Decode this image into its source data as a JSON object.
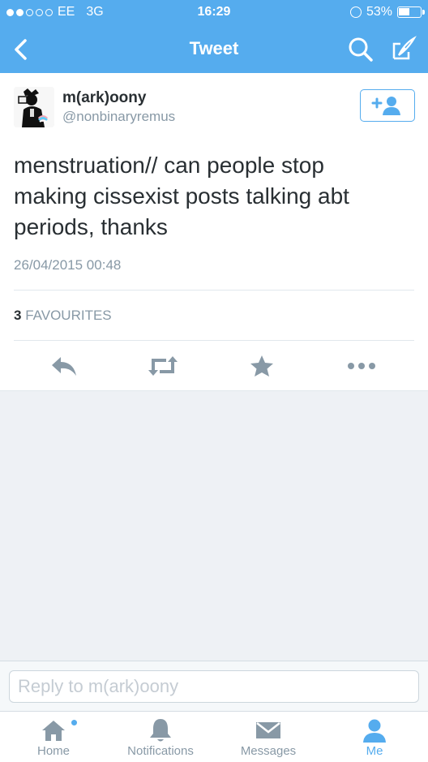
{
  "status_bar": {
    "carrier": "EE",
    "network": "3G",
    "time": "16:29",
    "battery_percent_label": "53%",
    "battery_level": 0.53,
    "signal_bars_filled": 2,
    "signal_bars_total": 5
  },
  "nav": {
    "title": "Tweet",
    "back_icon": "chevron-left-icon",
    "search_icon": "search-icon",
    "compose_icon": "compose-icon"
  },
  "tweet": {
    "display_name": "m(ark)oony",
    "handle": "@nonbinaryremus",
    "text": "menstruation// can people stop making cissexist posts talking abt periods, thanks",
    "timestamp": "26/04/2015 00:48",
    "favourites_count": "3",
    "favourites_label": "FAVOURITES",
    "follow_icon": "add-user-icon",
    "actions": [
      {
        "name": "reply",
        "icon": "reply-icon"
      },
      {
        "name": "retweet",
        "icon": "retweet-icon"
      },
      {
        "name": "favourite",
        "icon": "star-icon"
      },
      {
        "name": "more",
        "icon": "more-icon"
      }
    ]
  },
  "reply": {
    "placeholder": "Reply to m(ark)oony"
  },
  "tabs": [
    {
      "label": "Home",
      "icon": "home-icon",
      "active": false,
      "has_dot": true
    },
    {
      "label": "Notifications",
      "icon": "bell-icon",
      "active": false
    },
    {
      "label": "Messages",
      "icon": "envelope-icon",
      "active": false
    },
    {
      "label": "Me",
      "icon": "person-icon",
      "active": true
    }
  ],
  "colors": {
    "brand": "#55acee",
    "text": "#292f33",
    "muted": "#8899a6",
    "icon_gray": "#8899a6"
  }
}
